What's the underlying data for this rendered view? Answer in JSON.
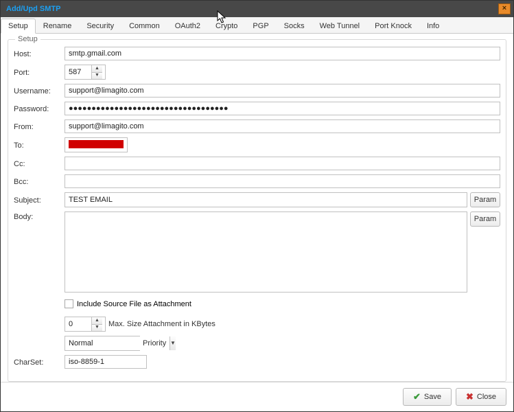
{
  "window": {
    "title": "Add/Upd SMTP"
  },
  "tabs": [
    "Setup",
    "Rename",
    "Security",
    "Common",
    "OAuth2",
    "Crypto",
    "PGP",
    "Socks",
    "Web Tunnel",
    "Port Knock",
    "Info"
  ],
  "activeTab": 0,
  "fieldset": {
    "legend": "Setup"
  },
  "labels": {
    "host": "Host:",
    "port": "Port:",
    "username": "Username:",
    "password": "Password:",
    "from": "From:",
    "to": "To:",
    "cc": "Cc:",
    "bcc": "Bcc:",
    "subject": "Subject:",
    "body": "Body:",
    "charset": "CharSet:",
    "includeAttachment": "Include Source File as Attachment",
    "maxSize": "Max. Size Attachment in KBytes",
    "priority": "Priority"
  },
  "values": {
    "host": "smtp.gmail.com",
    "port": "587",
    "username": "support@limagito.com",
    "password": "●●●●●●●●●●●●●●●●●●●●●●●●●●●●●●●●●●●",
    "from": "support@limagito.com",
    "to_redacted": true,
    "cc": "",
    "bcc": "",
    "subject": "TEST EMAIL",
    "body": "",
    "maxSize": "0",
    "priorityValue": "Normal",
    "charset": "iso-8859-1",
    "includeAttachment": false
  },
  "buttons": {
    "param": "Param",
    "save": "Save",
    "close": "Close"
  }
}
